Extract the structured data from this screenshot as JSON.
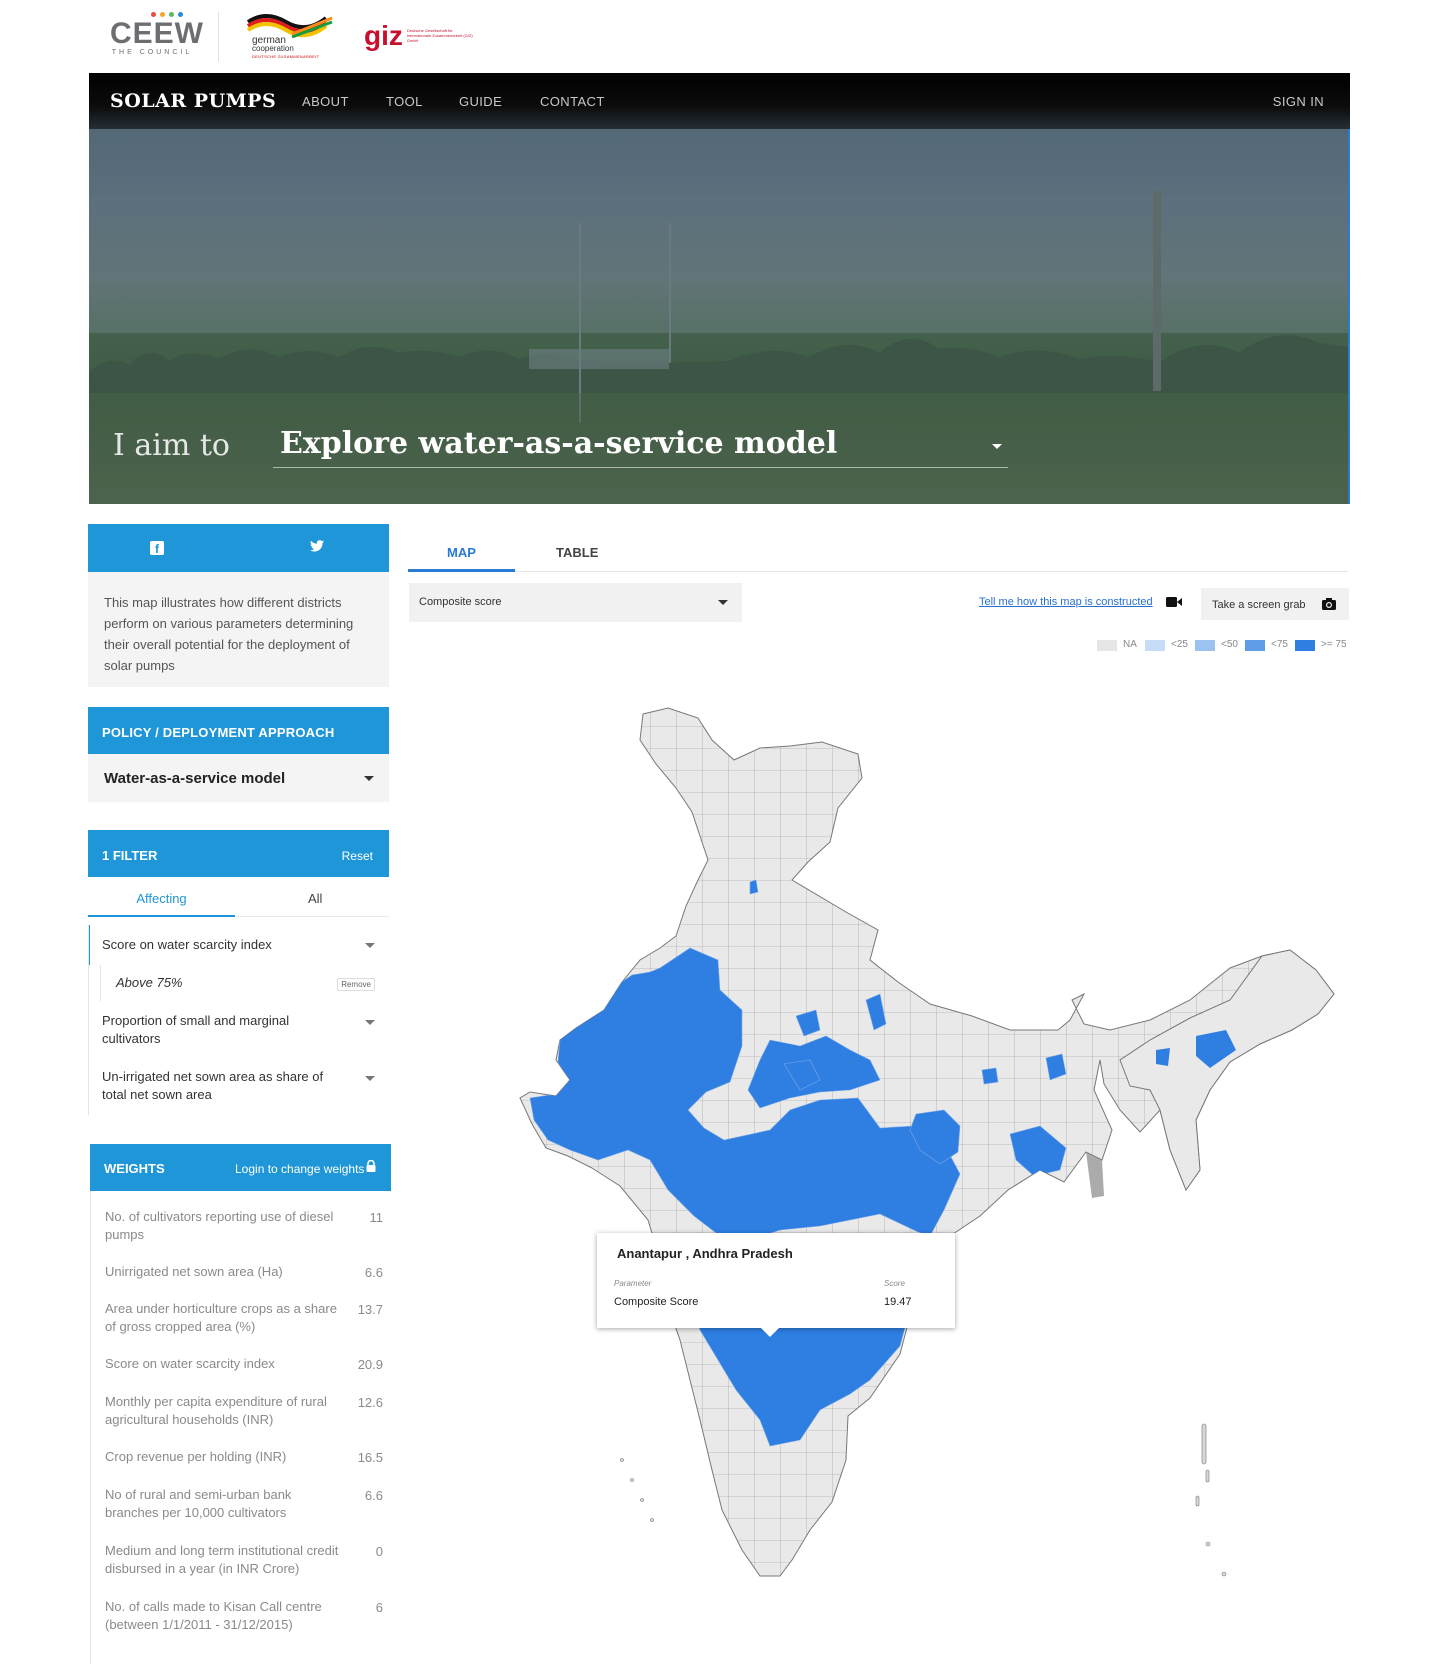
{
  "logos": {
    "ceew_word": "CEEW",
    "ceew_sub": "THE COUNCIL",
    "german_line1": "german",
    "german_line2": "cooperation",
    "german_line3": "DEUTSCHE ZUSAMMENARBEIT",
    "giz_word": "giz",
    "giz_sub": "Deutsche Gesellschaft für Internationale Zusammenarbeit (GIZ) GmbH"
  },
  "nav": {
    "brand": "SOLAR PUMPS",
    "links": [
      "ABOUT",
      "TOOL",
      "GUIDE",
      "CONTACT"
    ],
    "signin": "SIGN IN"
  },
  "hero": {
    "aim_label": "I aim to",
    "aim_value": "Explore water-as-a-service model"
  },
  "sidebar": {
    "intro": "This map illustrates how different districts perform on various parameters determining their overall potential for the deployment of solar pumps",
    "policy_head": "POLICY / DEPLOYMENT APPROACH",
    "policy_value": "Water-as-a-service model",
    "filter_head": "1 FILTER",
    "filter_reset": "Reset",
    "filter_tabs": [
      "Affecting",
      "All"
    ],
    "filters": [
      {
        "label": "Score on water scarcity index",
        "sub": "Above 75%",
        "remove": "Remove"
      },
      {
        "label": "Proportion of small and marginal cultivators"
      },
      {
        "label": "Un-irrigated net sown area as share of total net sown area"
      }
    ],
    "weights_head": "WEIGHTS",
    "weights_login": "Login to change weights",
    "weights": [
      {
        "label": "No. of cultivators reporting use of diesel pumps",
        "value": "11"
      },
      {
        "label": "Unirrigated net sown area (Ha)",
        "value": "6.6"
      },
      {
        "label": "Area under horticulture crops as a share of gross cropped area (%)",
        "value": "13.7"
      },
      {
        "label": "Score on water scarcity index",
        "value": "20.9"
      },
      {
        "label": "Monthly per capita expenditure of rural agricultural households (INR)",
        "value": "12.6"
      },
      {
        "label": "Crop revenue per holding (INR)",
        "value": "16.5"
      },
      {
        "label": "No of rural and semi-urban bank branches per 10,000 cultivators",
        "value": "6.6"
      },
      {
        "label": "Medium and long term institutional credit disbursed in a year (in INR Crore)",
        "value": "0"
      },
      {
        "label": "No. of calls made to Kisan Call centre (between 1/1/2011 - 31/12/2015)",
        "value": "6"
      }
    ]
  },
  "main": {
    "tabs": [
      "MAP",
      "TABLE"
    ],
    "parameter_select": "Composite score",
    "how_link": "Tell me how this map is constructed",
    "screen_grab": "Take a screen grab",
    "legend": [
      {
        "label": "NA",
        "color": "#e6e6e6"
      },
      {
        "label": "<25",
        "color": "#c7dcf6"
      },
      {
        "label": "<50",
        "color": "#9cc3f0"
      },
      {
        "label": "<75",
        "color": "#5f9de8"
      },
      {
        "label": ">= 75",
        "color": "#2f7fe3"
      }
    ],
    "tooltip": {
      "title": "Anantapur ,  Andhra Pradesh",
      "param_head": "Parameter",
      "score_head": "Score",
      "param": "Composite Score",
      "score": "19.47"
    }
  },
  "colors": {
    "accent": "#1f96d8",
    "map_blue": "#2f7fe3",
    "map_na": "#e6e6e6"
  }
}
